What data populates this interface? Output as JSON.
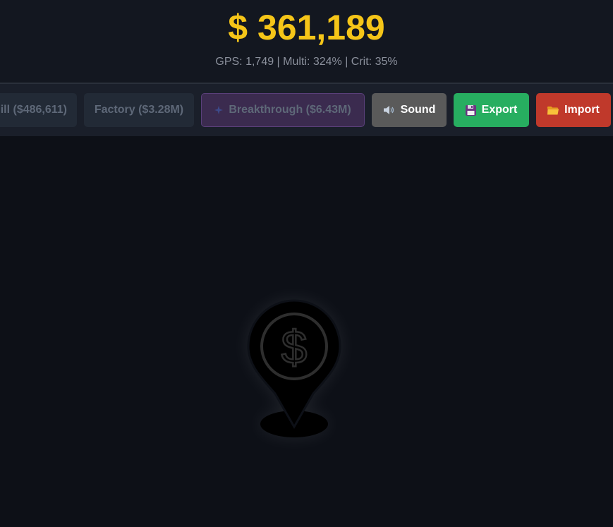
{
  "header": {
    "money": "$ 361,189",
    "stats": "GPS: 1,749 | Multi: 324% | Crit: 35%"
  },
  "toolbar": {
    "upgrades": [
      {
        "label": "ill ($486,611)"
      },
      {
        "label": "Factory ($3.28M)"
      }
    ],
    "breakthrough": {
      "label": "Breakthrough ($6.43M)",
      "icon": "sparkle-icon"
    },
    "sound": {
      "label": "Sound",
      "icon": "speaker-icon"
    },
    "export": {
      "label": "Export",
      "icon": "floppy-disk-icon"
    },
    "import": {
      "label": "Import",
      "icon": "folder-icon"
    }
  },
  "main": {
    "clicker_icon": "money-location-pin-icon"
  },
  "colors": {
    "accent_gold": "#f5c518",
    "export_green": "#27ae60",
    "import_red": "#c0392b",
    "sound_gray": "#5a5a5a",
    "background": "#0d1017"
  }
}
